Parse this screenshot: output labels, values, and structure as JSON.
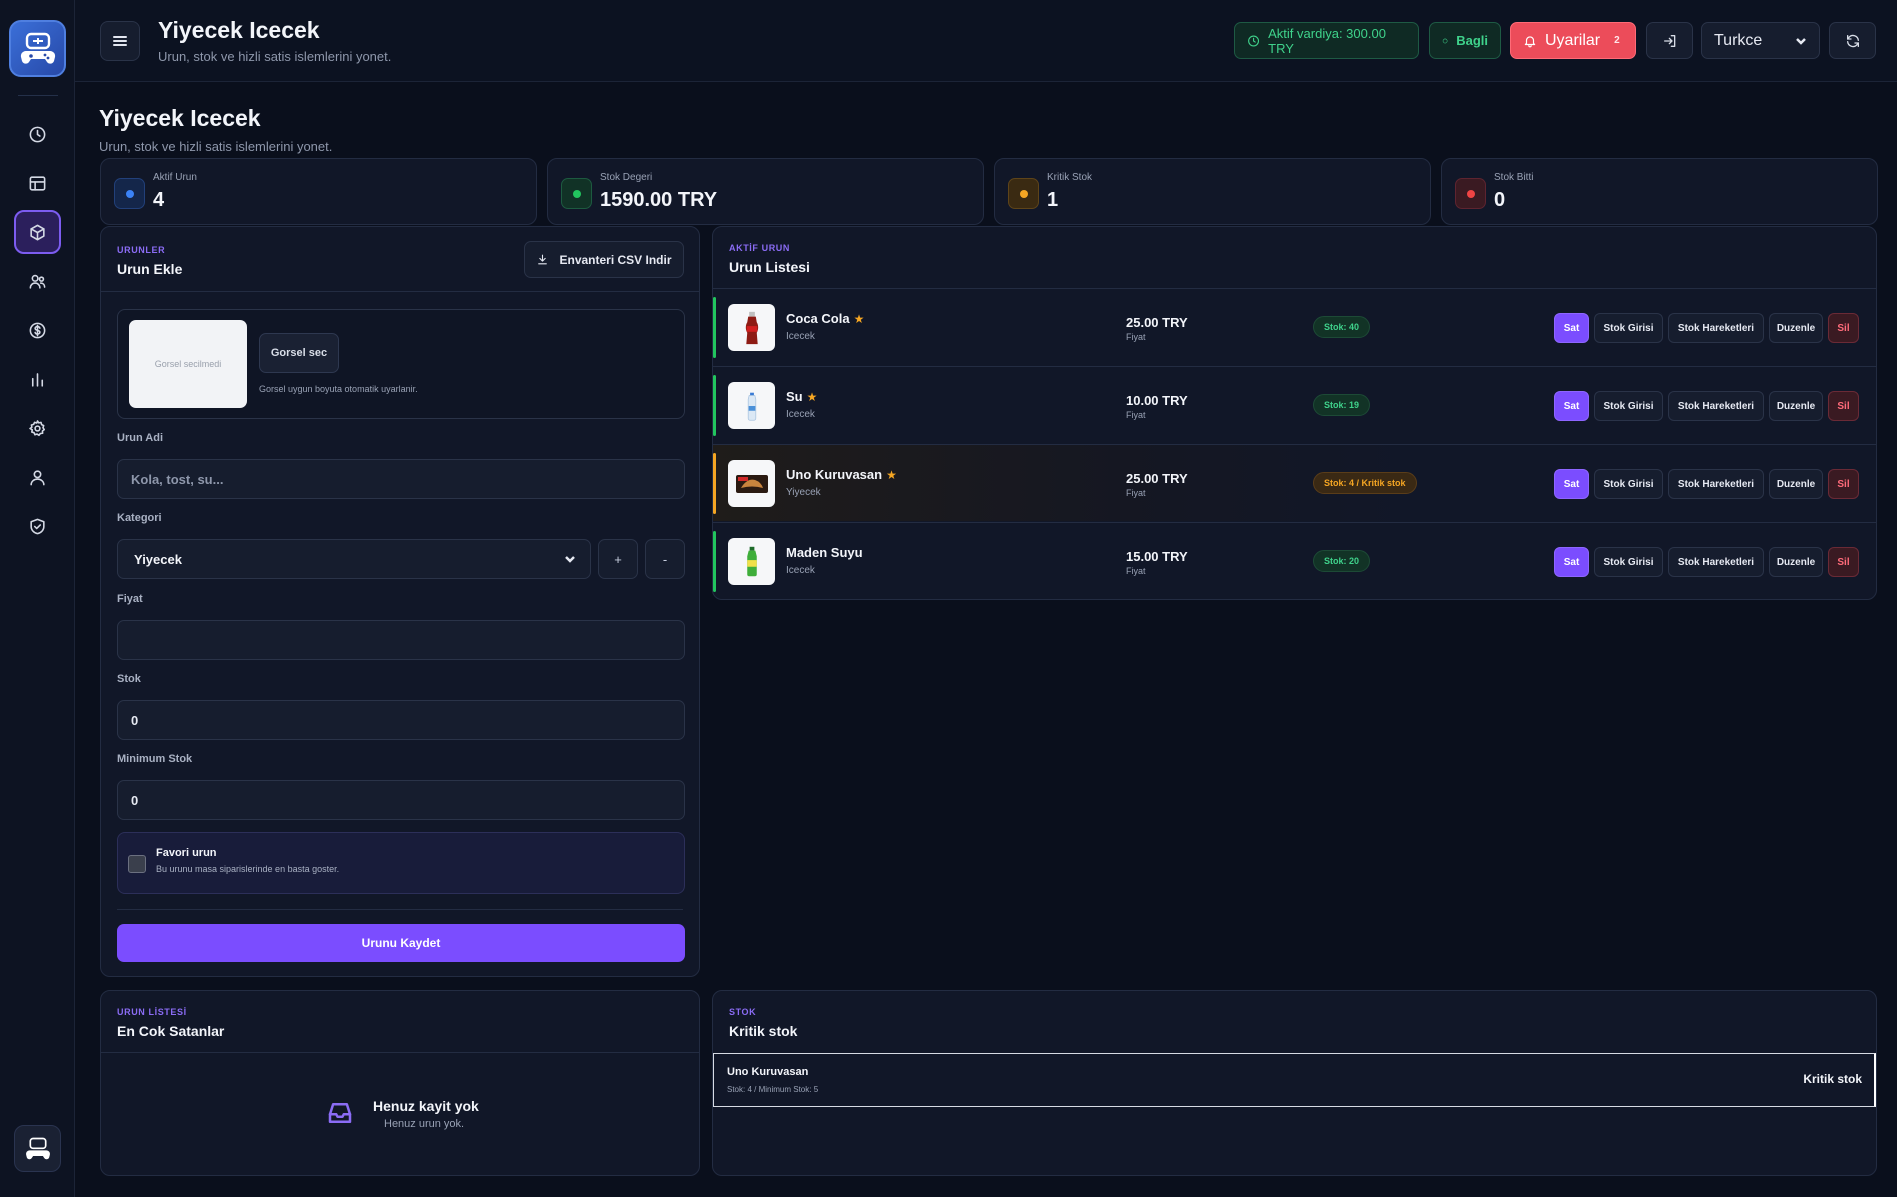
{
  "header": {
    "title": "Yiyecek Icecek",
    "subtitle": "Urun, stok ve hizli satis islemlerini yonet.",
    "shift_label": "Aktif vardiya: 300.00 TRY",
    "connection_label": "Bagli",
    "alerts_label": "Uyarilar",
    "alerts_count": "2",
    "language": "Turkce"
  },
  "page": {
    "title": "Yiyecek Icecek",
    "subtitle": "Urun, stok ve hizli satis islemlerini yonet."
  },
  "stats": [
    {
      "label": "Aktif Urun",
      "value": "4",
      "color": "#3b82f6"
    },
    {
      "label": "Stok Degeri",
      "value": "1590.00 TRY",
      "color": "#22c55e"
    },
    {
      "label": "Kritik Stok",
      "value": "1",
      "color": "#f5a623"
    },
    {
      "label": "Stok Bitti",
      "value": "0",
      "color": "#ef4444"
    }
  ],
  "add_form": {
    "kicker": "URUNLER",
    "title": "Urun Ekle",
    "csv_button": "Envanteri CSV Indir",
    "image_placeholder": "Gorsel secilmedi",
    "image_button": "Gorsel sec",
    "image_hint": "Gorsel uygun boyuta otomatik uyarlanir.",
    "name_label": "Urun Adi",
    "name_placeholder": "Kola, tost, su...",
    "category_label": "Kategori",
    "category_value": "Yiyecek",
    "add_category": "+",
    "remove_category": "-",
    "price_label": "Fiyat",
    "price_value": "",
    "stock_label": "Stok",
    "stock_value": "0",
    "min_stock_label": "Minimum Stok",
    "min_stock_value": "0",
    "favorite_title": "Favori urun",
    "favorite_desc": "Bu urunu masa siparislerinde en basta goster.",
    "save_button": "Urunu Kaydet"
  },
  "product_list": {
    "kicker": "AKTİF URUN",
    "title": "Urun Listesi",
    "price_caption": "Fiyat",
    "actions": {
      "sell": "Sat",
      "stock_in": "Stok Girisi",
      "movements": "Stok Hareketleri",
      "edit": "Duzenle",
      "delete": "Sil"
    },
    "items": [
      {
        "name": "Coca Cola",
        "favorite": true,
        "category": "Icecek",
        "price": "25.00 TRY",
        "stock": "Stok: 40",
        "status": "ok",
        "icon": "cola-bottle-icon"
      },
      {
        "name": "Su",
        "favorite": true,
        "category": "Icecek",
        "price": "10.00 TRY",
        "stock": "Stok: 19",
        "status": "ok",
        "icon": "water-bottle-icon"
      },
      {
        "name": "Uno Kuruvasan",
        "favorite": true,
        "category": "Yiyecek",
        "price": "25.00 TRY",
        "stock": "Stok: 4 / Kritik stok",
        "status": "warn",
        "icon": "croissant-pack-icon"
      },
      {
        "name": "Maden Suyu",
        "favorite": false,
        "category": "Icecek",
        "price": "15.00 TRY",
        "stock": "Stok: 20",
        "status": "ok",
        "icon": "mineral-water-icon"
      }
    ]
  },
  "best_sellers": {
    "kicker": "URUN LİSTESİ",
    "title": "En Cok Satanlar",
    "empty_title": "Henuz kayit yok",
    "empty_sub": "Henuz urun yok."
  },
  "critical": {
    "kicker": "STOK",
    "title": "Kritik stok",
    "items": [
      {
        "name": "Uno Kuruvasan",
        "desc": "Stok: 4 / Minimum Stok: 5",
        "tag": "Kritik stok"
      }
    ]
  },
  "sidebar": {
    "items": [
      "clock-icon",
      "table-icon",
      "box-icon",
      "users-icon",
      "dollar-icon",
      "bar-chart-icon",
      "gear-icon",
      "user-icon",
      "shield-icon"
    ],
    "active": "box-icon"
  }
}
